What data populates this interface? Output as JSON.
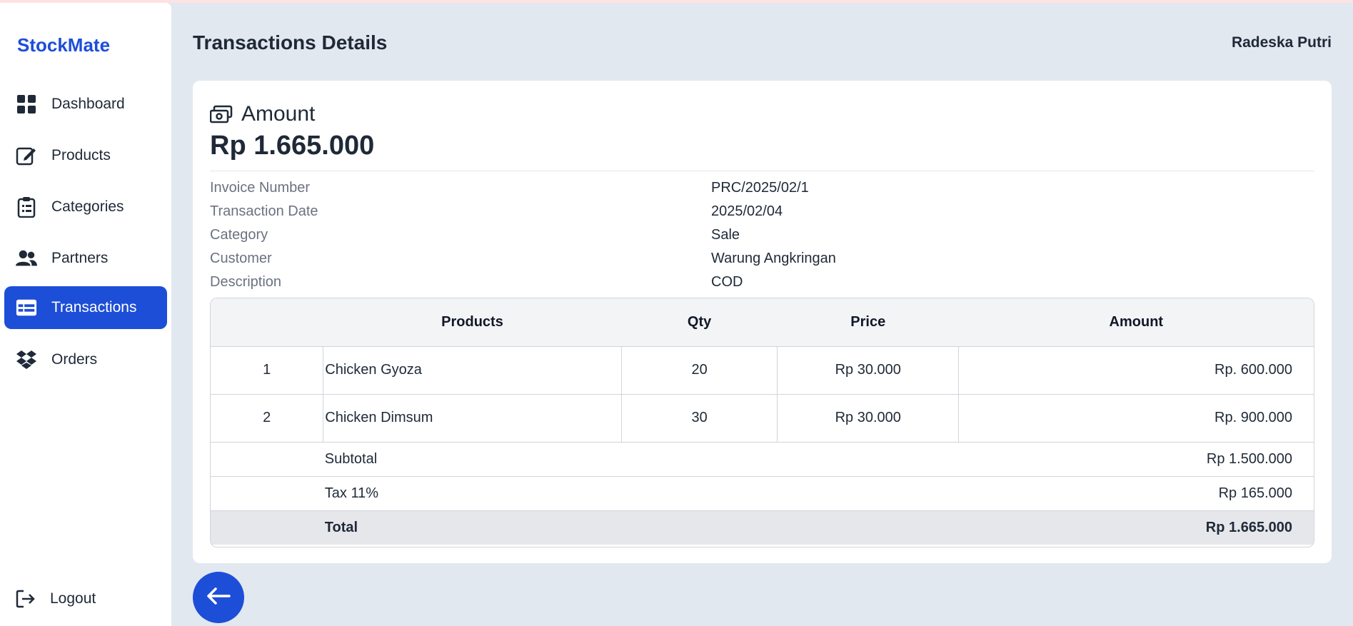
{
  "app": {
    "brand": "StockMate"
  },
  "sidebar": {
    "items": [
      {
        "label": "Dashboard",
        "icon": "dashboard-icon"
      },
      {
        "label": "Products",
        "icon": "edit-icon"
      },
      {
        "label": "Categories",
        "icon": "clipboard-icon"
      },
      {
        "label": "Partners",
        "icon": "users-icon"
      },
      {
        "label": "Transactions",
        "icon": "table-icon",
        "active": true
      },
      {
        "label": "Orders",
        "icon": "dropbox-icon"
      }
    ],
    "logout_label": "Logout"
  },
  "header": {
    "title": "Transactions Details",
    "user": "Radeska Putri"
  },
  "amount": {
    "label": "Amount",
    "value": "Rp 1.665.000"
  },
  "details": [
    {
      "label": "Invoice Number",
      "value": "PRC/2025/02/1"
    },
    {
      "label": "Transaction Date",
      "value": "2025/02/04"
    },
    {
      "label": "Category",
      "value": "Sale"
    },
    {
      "label": "Customer",
      "value": "Warung Angkringan"
    },
    {
      "label": "Description",
      "value": "COD"
    }
  ],
  "table": {
    "headers": {
      "no": "",
      "products": "Products",
      "qty": "Qty",
      "price": "Price",
      "amount": "Amount"
    },
    "rows": [
      {
        "no": "1",
        "product": "Chicken Gyoza",
        "qty": "20",
        "price": "Rp 30.000",
        "amount": "Rp. 600.000"
      },
      {
        "no": "2",
        "product": "Chicken Dimsum",
        "qty": "30",
        "price": "Rp 30.000",
        "amount": "Rp. 900.000"
      }
    ],
    "subtotal_label": "Subtotal",
    "subtotal_value": "Rp 1.500.000",
    "tax_label": "Tax 11%",
    "tax_value": "Rp 165.000",
    "total_label": "Total",
    "total_value": "Rp 1.665.000"
  },
  "colors": {
    "accent": "#1d4ed8",
    "background": "#e2e8f0"
  }
}
